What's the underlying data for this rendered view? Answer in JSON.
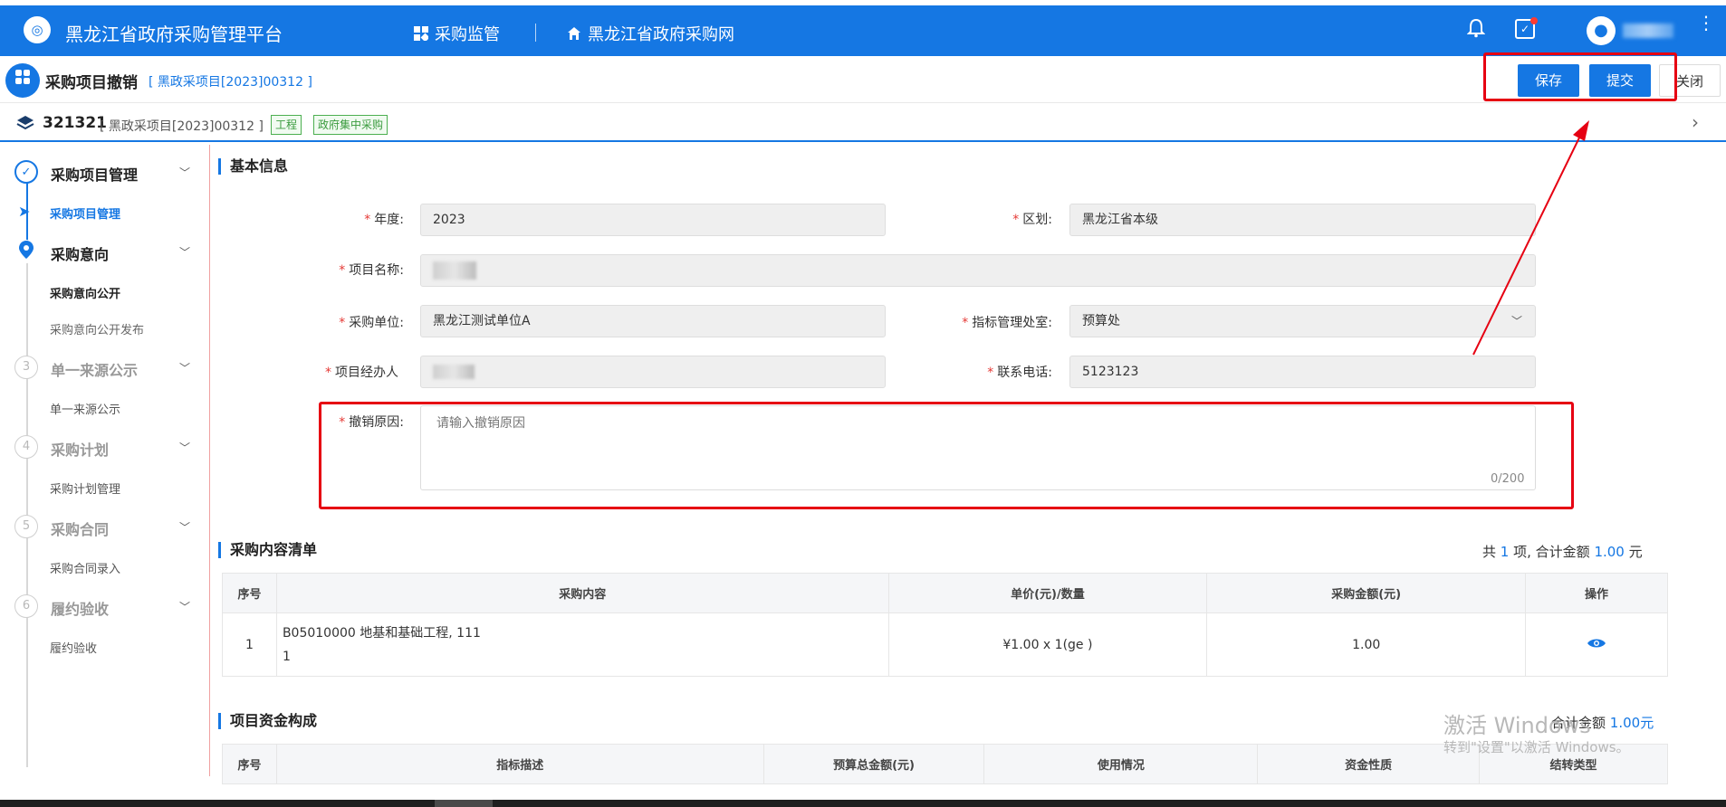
{
  "topbar": {
    "logo_glyph": "◎",
    "app_title": "黑龙江省政府采购管理平台",
    "nav": [
      {
        "label": "采购监管",
        "icon": "grid-icon"
      },
      {
        "label": "黑龙江省政府采购网",
        "icon": "home-icon"
      }
    ],
    "bell_glyph": "🔔",
    "task_glyph": "✓",
    "avatar_glyph": "●",
    "kebab_glyph": "⋮"
  },
  "header": {
    "title": "采购项目撤销",
    "code": "[ 黑政采项目[2023]00312 ]",
    "save_label": "保存",
    "submit_label": "提交",
    "close_label": "关闭"
  },
  "project_bar": {
    "id": "321321",
    "code": "[ 黑政采项目[2023]00312 ]",
    "tags": [
      "工程",
      "政府集中采购"
    ],
    "arrow_glyph": "›"
  },
  "sidebar": {
    "steps": [
      {
        "title": "采购项目管理",
        "marker": "✓",
        "items": [
          "采购项目管理"
        ]
      },
      {
        "title": "采购意向",
        "marker": "●",
        "items": [
          "采购意向公开",
          "采购意向公开发布"
        ]
      },
      {
        "title": "单一来源公示",
        "marker": "3",
        "items": [
          "单一来源公示"
        ]
      },
      {
        "title": "采购计划",
        "marker": "4",
        "items": [
          "采购计划管理"
        ]
      },
      {
        "title": "采购合同",
        "marker": "5",
        "items": [
          "采购合同录入"
        ]
      },
      {
        "title": "履约验收",
        "marker": "6",
        "items": [
          "履约验收"
        ]
      }
    ]
  },
  "basic_info": {
    "section_title": "基本信息",
    "year_label": "年度:",
    "year_value": "2023",
    "region_label": "区划:",
    "region_value": "黑龙江省本级",
    "project_name_label": "项目名称:",
    "unit_label": "采购单位:",
    "unit_value": "黑龙江测试单位A",
    "office_label": "指标管理处室:",
    "office_value": "预算处",
    "manager_label": "项目经办人",
    "phone_label": "联系电话:",
    "phone_value": "5123123",
    "reason_label": "撤销原因:",
    "reason_placeholder": "请输入撤销原因",
    "reason_counter": "0/200",
    "required_mark": "*"
  },
  "content_list": {
    "section_title": "采购内容清单",
    "summary_prefix": "共",
    "summary_count": "1",
    "summary_mid": "项,  合计金额",
    "summary_amount": "1.00",
    "summary_suffix": "元",
    "headers": [
      "序号",
      "采购内容",
      "单价(元)/数量",
      "采购金额(元)",
      "操作"
    ],
    "rows": [
      {
        "index": "1",
        "content_line1": "B05010000 地基和基础工程, 111",
        "content_line2": "1",
        "price_qty": "¥1.00 x 1(ge )",
        "amount": "1.00",
        "action_icon": "👁"
      }
    ]
  },
  "funding": {
    "section_title": "项目资金构成",
    "summary_label": "合计金额",
    "summary_amount": "1.00元",
    "headers": [
      "序号",
      "指标描述",
      "预算总金额(元)",
      "使用情况",
      "资金性质",
      "结转类型"
    ]
  },
  "watermark": {
    "line1": "激活 Windows",
    "line2": "转到\"设置\"以激活 Windows。"
  },
  "colors": {
    "primary": "#1577e3",
    "highlight": "#e60012",
    "tag": "#3a9b3e"
  }
}
